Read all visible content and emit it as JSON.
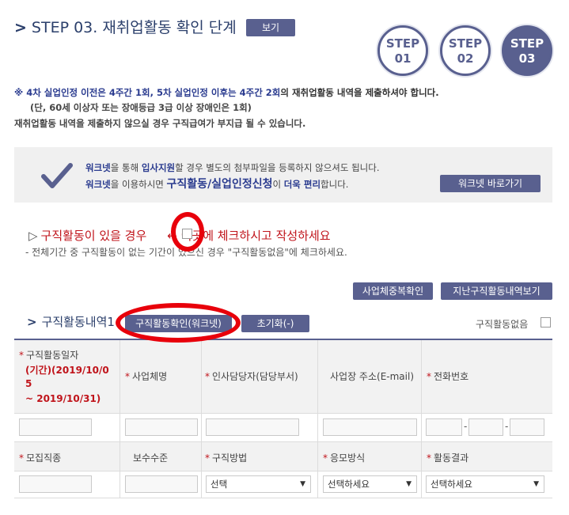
{
  "header": {
    "title": "STEP 03. 재취업활동 확인 단계",
    "view_label": "보기",
    "steps": [
      {
        "line1": "STEP",
        "line2": "01"
      },
      {
        "line1": "STEP",
        "line2": "02"
      },
      {
        "line1": "STEP",
        "line2": "03"
      }
    ]
  },
  "notice": {
    "star": "※",
    "part1": "4차 실업인정 이전은 4주간 1회, 5차 실업인정 이후는 4주간 2회",
    "part2": "의 재취업활동 내역을 제출하셔야 합니다.",
    "line2": "(단, 60세 이상자 또는 장애등급 3급 이상 장애인은 1회)",
    "line3": "재취업활동 내역을 제출하지 않으실 경우 구직급여가 부지급 될 수 있습니다."
  },
  "worknet": {
    "l1_a": "워크넷",
    "l1_b": "을 통해 ",
    "l1_c": "입사지원",
    "l1_d": "할 경우 별도의 첨부파일을 등록하지 않으셔도 됩니다.",
    "l2_a": "워크넷",
    "l2_b": "을 이용하시면 ",
    "l2_c": "구직활동/실업인정신청",
    "l2_d": "이 ",
    "l2_e": "더욱 편리",
    "l2_f": "합니다.",
    "button": "워크넷 바로가기"
  },
  "instruction": {
    "tri": "▷",
    "text_before": "구직활동이 있을 경우",
    "text_after": "← 이곳에 체크하시고 작성하세요",
    "sub": "- 전체기간 중 구직활동이 없는 기간이 있으신 경우 \"구직활동없음\"에 체크하세요."
  },
  "buttons": {
    "dup": "사업체중복확인",
    "history": "지난구직활동내역보기",
    "confirm": "구직활동확인(워크넷)",
    "reset": "초기화(-)"
  },
  "section": {
    "title": "구직활동내역1",
    "none_label": "구직활동없음"
  },
  "table": {
    "h_date_1": "구직활동일자",
    "h_date_2": "(기간)(2019/10/0",
    "h_date_3": "5",
    "h_date_4": "~ 2019/10/31)",
    "h_company": "사업체명",
    "h_manager": "인사담당자(담당부서)",
    "h_address": "사업장 주소(E-mail)",
    "h_phone": "전화번호",
    "h_job": "모집직종",
    "h_pay": "보수수준",
    "h_method": "구직방법",
    "h_apply": "응모방식",
    "h_result": "활동결과",
    "sel_method": "선택",
    "sel_apply": "선택하세요",
    "sel_result": "선택하세요",
    "req_mark": "*",
    "dash": "-"
  },
  "colors": {
    "accent": "#59608f",
    "required": "#c0141b",
    "annotation": "#e8000b"
  }
}
